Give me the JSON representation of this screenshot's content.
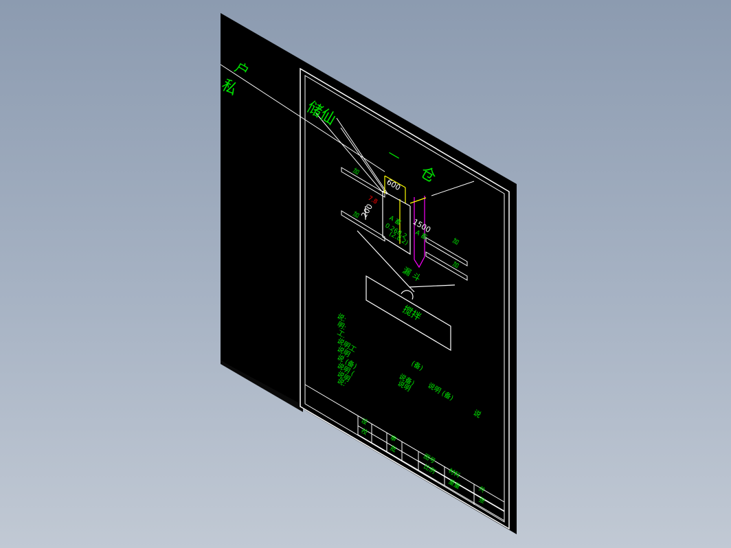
{
  "colors": {
    "background_top": "#8c9bb0",
    "background_bottom": "#c1c9d4",
    "sheet": "#000000",
    "frame": "#ffffff",
    "text": "#00e100",
    "dimension_yellow": "#ffff00",
    "dimension_magenta": "#ff00ff",
    "annotation_red": "#ff0000"
  },
  "drawing": {
    "stray_labels": [
      "户",
      "私"
    ],
    "dim_horizontal": "600",
    "dim_vertical_left": "200",
    "dim_vertical_right": "1500",
    "dim_small": "0.5",
    "dim_tag_red": "7.8",
    "title_left": "ᅳ",
    "title_right": "仓",
    "top_label": "储仙",
    "level_tag_1": "加",
    "level_tag_2": "加",
    "level_tag_3": "加",
    "level_tag_4": "加",
    "body_line_1": "A 畜",
    "body_line_2": "0.26B.2",
    "body_line_3": "(2.8.2)",
    "right_body_line": "A 畜",
    "funnel_label": "漏 斗",
    "box_label": "搅拌",
    "notes": [
      "说:",
      "明:",
      "工.",
      "说明工",
      "说明",
      "说 (备)",
      "说明 (",
      "说明 ",
      "说:"
    ],
    "notes_mid": [
      "(备)",
      "说备)",
      "说明 (备)",
      "说明"
    ],
    "note_right": "说",
    "table_cells": [
      "设",
      "校",
      "审",
      "批",
      "图号",
      "比例",
      "材料",
      "重量",
      "共",
      "张"
    ]
  }
}
